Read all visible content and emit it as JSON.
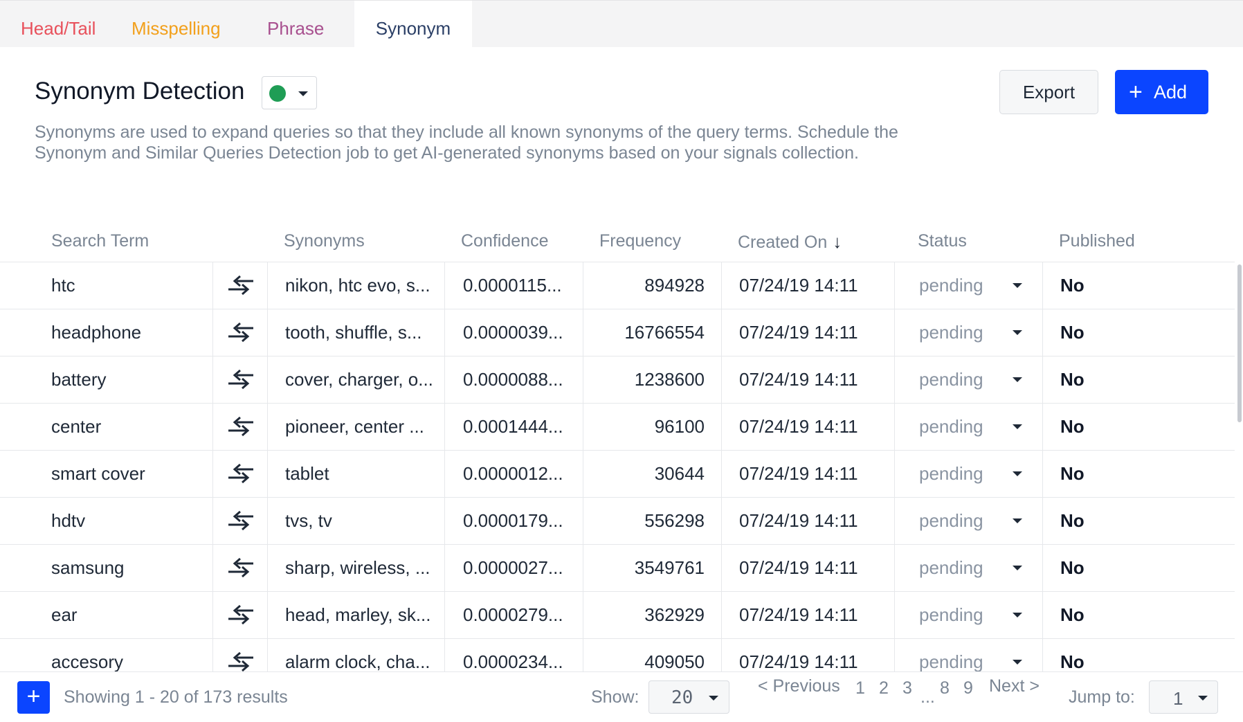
{
  "tabs": [
    {
      "label": "Head/Tail",
      "color": "#e8505b"
    },
    {
      "label": "Misspelling",
      "color": "#f2a01c"
    },
    {
      "label": "Phrase",
      "color": "#a8508f"
    },
    {
      "label": "Synonym",
      "color": "#2b3f66",
      "active": true
    }
  ],
  "header": {
    "title": "Synonym Detection",
    "status_indicator_color": "#1f9d55",
    "description": "Synonyms are used to expand queries so that they include all known synonyms of the query terms. Schedule the Synonym and Similar Queries Detection job to get AI-generated synonyms based on your signals collection.",
    "export_label": "Export",
    "add_label": "Add",
    "accent_color": "#0b45ff"
  },
  "table": {
    "columns": {
      "search_term": "Search Term",
      "synonyms": "Synonyms",
      "confidence": "Confidence",
      "frequency": "Frequency",
      "created_on": "Created On",
      "status": "Status",
      "published": "Published"
    },
    "sort_column": "created_on",
    "sort_direction": "descending",
    "rows": [
      {
        "term": "htc",
        "synonyms": "nikon, htc evo, s...",
        "confidence": "0.0000115...",
        "frequency": "894928",
        "created": "07/24/19 14:11",
        "status": "pending",
        "published": "No"
      },
      {
        "term": "headphone",
        "synonyms": "tooth, shuffle, s...",
        "confidence": "0.0000039...",
        "frequency": "16766554",
        "created": "07/24/19 14:11",
        "status": "pending",
        "published": "No"
      },
      {
        "term": "battery",
        "synonyms": "cover, charger, o...",
        "confidence": "0.0000088...",
        "frequency": "1238600",
        "created": "07/24/19 14:11",
        "status": "pending",
        "published": "No"
      },
      {
        "term": "center",
        "synonyms": "pioneer, center ...",
        "confidence": "0.0001444...",
        "frequency": "96100",
        "created": "07/24/19 14:11",
        "status": "pending",
        "published": "No"
      },
      {
        "term": "smart cover",
        "synonyms": "tablet",
        "confidence": "0.0000012...",
        "frequency": "30644",
        "created": "07/24/19 14:11",
        "status": "pending",
        "published": "No"
      },
      {
        "term": "hdtv",
        "synonyms": "tvs, tv",
        "confidence": "0.0000179...",
        "frequency": "556298",
        "created": "07/24/19 14:11",
        "status": "pending",
        "published": "No"
      },
      {
        "term": "samsung",
        "synonyms": "sharp, wireless, ...",
        "confidence": "0.0000027...",
        "frequency": "3549761",
        "created": "07/24/19 14:11",
        "status": "pending",
        "published": "No"
      },
      {
        "term": "ear",
        "synonyms": "head, marley, sk...",
        "confidence": "0.0000279...",
        "frequency": "362929",
        "created": "07/24/19 14:11",
        "status": "pending",
        "published": "No"
      },
      {
        "term": "accesory",
        "synonyms": "alarm clock, cha...",
        "confidence": "0.0000234...",
        "frequency": "409050",
        "created": "07/24/19 14:11",
        "status": "pending",
        "published": "No"
      }
    ]
  },
  "footer": {
    "add_label": "+",
    "showing": "Showing 1 - 20 of 173 results",
    "show_label": "Show:",
    "page_size": "20",
    "prev_label": "< Previous",
    "next_label": "Next >",
    "pages": [
      "1",
      "2",
      "3",
      "8",
      "9"
    ],
    "ellipsis": "...",
    "jump_label": "Jump to:",
    "jump_value": "1"
  },
  "icons": {
    "swap": "swap-arrows-icon",
    "sort": "arrow-down-icon",
    "dropdown": "caret-down-icon",
    "add": "plus-icon",
    "status": "status-dot-icon"
  }
}
